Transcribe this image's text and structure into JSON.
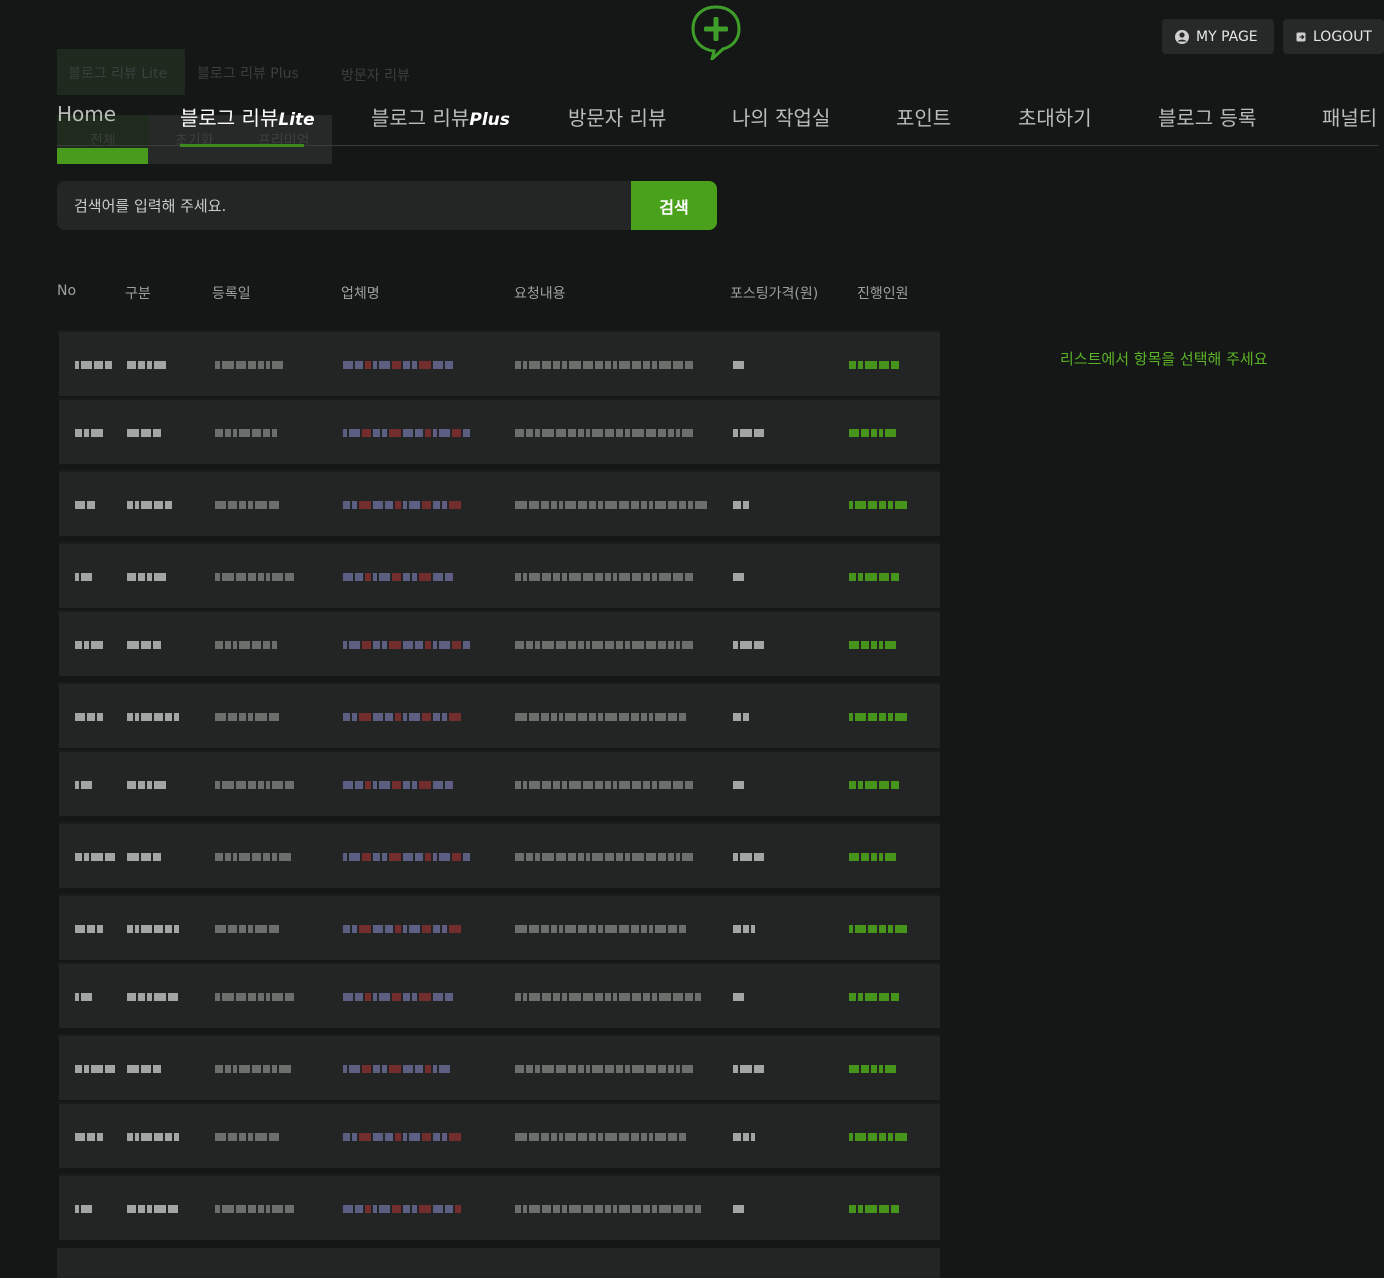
{
  "header": {
    "my_page_label": "MY PAGE",
    "logout_label": "LOGOUT"
  },
  "ghost_tabs": [
    "블로그 리뷰 Lite",
    "블로그 리뷰 Plus",
    "방문자 리뷰",
    "전체",
    "초기화",
    "프리미엄"
  ],
  "nav": {
    "items": [
      {
        "label": "Home",
        "suffix": ""
      },
      {
        "label": "블로그 리뷰",
        "suffix": "Lite"
      },
      {
        "label": "블로그 리뷰",
        "suffix": "Plus"
      },
      {
        "label": "방문자 리뷰",
        "suffix": ""
      },
      {
        "label": "나의 작업실",
        "suffix": ""
      },
      {
        "label": "포인트",
        "suffix": ""
      },
      {
        "label": "초대하기",
        "suffix": ""
      },
      {
        "label": "블로그 등록",
        "suffix": ""
      },
      {
        "label": "패널티",
        "suffix": ""
      }
    ],
    "active_index": 1
  },
  "search": {
    "placeholder": "검색어를 입력해 주세요.",
    "button_label": "검색"
  },
  "table": {
    "columns": [
      "No",
      "구분",
      "등록일",
      "업체명",
      "요청내용",
      "포스팅가격(원)",
      "진행인원"
    ],
    "row_count": 13
  },
  "detail": {
    "empty_message": "리스트에서 항목을 선택해 주세요"
  },
  "colors": {
    "background": "#151716",
    "accent": "#4aa11c",
    "row_bg": "#222524"
  }
}
